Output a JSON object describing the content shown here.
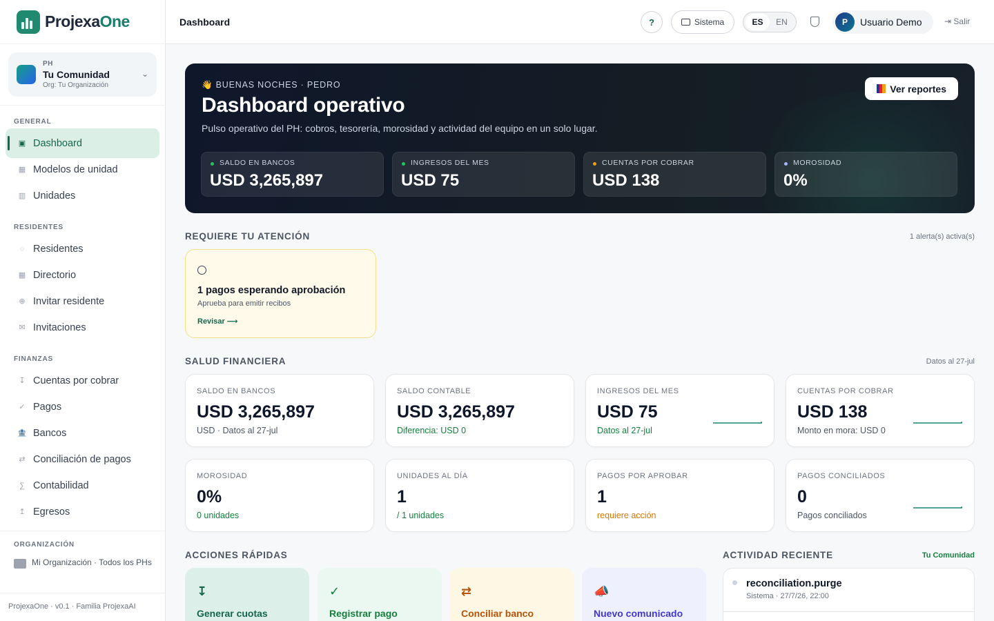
{
  "app": {
    "name_a": "Projexa",
    "name_b": "One",
    "version": "ProjexaOne · v0.1 · Familia ProjexaAI"
  },
  "org_switcher": {
    "kind": "PH",
    "name": "Tu Comunidad",
    "org": "Org: Tu Organización"
  },
  "sidebar": {
    "sections": [
      "GENERAL",
      "RESIDENTES",
      "FINANZAS",
      "ORGANIZACIÓN"
    ],
    "items": [
      {
        "label": "Dashboard",
        "icon": "▣"
      },
      {
        "label": "Modelos de unidad",
        "icon": "▦"
      },
      {
        "label": "Unidades",
        "icon": "▥"
      },
      {
        "label": "Residentes",
        "icon": "◌"
      },
      {
        "label": "Directorio",
        "icon": "▦"
      },
      {
        "label": "Invitar residente",
        "icon": "⊕"
      },
      {
        "label": "Invitaciones",
        "icon": "✉"
      },
      {
        "label": "Cuentas por cobrar",
        "icon": "↧"
      },
      {
        "label": "Pagos",
        "icon": "✓"
      },
      {
        "label": "Bancos",
        "icon": "🏦"
      },
      {
        "label": "Conciliación de pagos",
        "icon": "⇄"
      },
      {
        "label": "Contabilidad",
        "icon": "∑"
      },
      {
        "label": "Egresos",
        "icon": "↥"
      }
    ],
    "org_item": "Mi Organización · Todos los PHs"
  },
  "topbar": {
    "title": "Dashboard",
    "help": "?",
    "system": "Sistema",
    "lang_es": "ES",
    "lang_en": "EN",
    "user_initial": "P",
    "user_name": "Usuario Demo",
    "logout": "Salir"
  },
  "hero": {
    "greeting": "BUENAS NOCHES · PEDRO",
    "title": "Dashboard operativo",
    "subtitle": "Pulso operativo del PH: cobros, tesorería, morosidad y actividad del equipo en un solo lugar.",
    "button": "Ver reportes",
    "kpis": [
      {
        "label": "SALDO EN BANCOS",
        "value": "USD 3,265,897",
        "color": "#22c55e"
      },
      {
        "label": "INGRESOS DEL MES",
        "value": "USD 75",
        "color": "#22c55e"
      },
      {
        "label": "CUENTAS POR COBRAR",
        "value": "USD 138",
        "color": "#f59e0b"
      },
      {
        "label": "MOROSIDAD",
        "value": "0%",
        "color": "#a5b4fc"
      }
    ]
  },
  "attention": {
    "title": "REQUIERE TU ATENCIÓN",
    "note": "1 alerta(s) activa(s)",
    "alert": {
      "title": "1 pagos esperando aprobación",
      "desc": "Aprueba para emitir recibos",
      "action": "Revisar ⟶"
    }
  },
  "finance": {
    "title": "SALUD FINANCIERA",
    "note": "Datos al 27-jul",
    "cards": [
      {
        "label": "SALDO EN BANCOS",
        "value": "USD 3,265,897",
        "sub": "USD · Datos al 27-jul",
        "sub_color": "#4b5563",
        "spark": false
      },
      {
        "label": "SALDO CONTABLE",
        "value": "USD 3,265,897",
        "sub": "Diferencia: USD 0",
        "sub_color": "#15803d",
        "spark": false
      },
      {
        "label": "INGRESOS DEL MES",
        "value": "USD 75",
        "sub": "Datos al 27-jul",
        "sub_color": "#15803d",
        "spark": true
      },
      {
        "label": "CUENTAS POR COBRAR",
        "value": "USD 138",
        "sub": "Monto en mora: USD 0",
        "sub_color": "#4b5563",
        "spark": true
      },
      {
        "label": "MOROSIDAD",
        "value": "0%",
        "sub": "0 unidades",
        "sub_color": "#15803d",
        "spark": false
      },
      {
        "label": "UNIDADES AL DÍA",
        "value": "1",
        "sub": "/ 1 unidades",
        "sub_color": "#15803d",
        "spark": false
      },
      {
        "label": "PAGOS POR APROBAR",
        "value": "1",
        "sub": "requiere acción",
        "sub_color": "#d97706",
        "spark": false
      },
      {
        "label": "PAGOS CONCILIADOS",
        "value": "0",
        "sub": "Pagos conciliados",
        "sub_color": "#4b5563",
        "spark": true
      }
    ]
  },
  "quick_actions": {
    "title": "ACCIONES RÁPIDAS",
    "items": [
      {
        "label": "Generar cuotas",
        "icon": "↧",
        "bg": "#dcefe8",
        "fg": "#14664f"
      },
      {
        "label": "Registrar pago",
        "icon": "✓",
        "bg": "#eaf8f1",
        "fg": "#15803d"
      },
      {
        "label": "Conciliar banco",
        "icon": "⇄",
        "bg": "#fef7e4",
        "fg": "#b45309"
      },
      {
        "label": "Nuevo comunicado",
        "icon": "📣",
        "bg": "#eef1fd",
        "fg": "#4338ca"
      }
    ]
  },
  "activity": {
    "title": "ACTIVIDAD RECIENTE",
    "scope": "Tu Comunidad",
    "items": [
      {
        "name": "reconciliation.purge",
        "meta": "Sistema · 27/7/26, 22:00"
      }
    ]
  }
}
